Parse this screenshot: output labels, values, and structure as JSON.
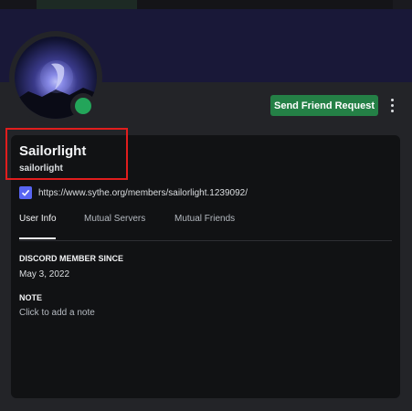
{
  "profile": {
    "display_name": "Sailorlight",
    "username": "sailorlight",
    "status": "online",
    "status_color": "#23a55a"
  },
  "actions": {
    "send_friend_request_label": "Send Friend Request",
    "more_icon": "more-vertical-icon"
  },
  "connection": {
    "icon": "checkbox-checked-icon",
    "url": "https://www.sythe.org/members/sailorlight.1239092/"
  },
  "tabs": [
    {
      "label": "User Info",
      "active": true
    },
    {
      "label": "Mutual Servers",
      "active": false
    },
    {
      "label": "Mutual Friends",
      "active": false
    }
  ],
  "user_info": {
    "member_since_title": "DISCORD MEMBER SINCE",
    "member_since_value": "May 3, 2022",
    "note_title": "NOTE",
    "note_placeholder": "Click to add a note"
  },
  "colors": {
    "accent_button": "#248046",
    "highlight": "#e11d1d",
    "checkbox": "#5865f2",
    "banner": "#191838"
  }
}
